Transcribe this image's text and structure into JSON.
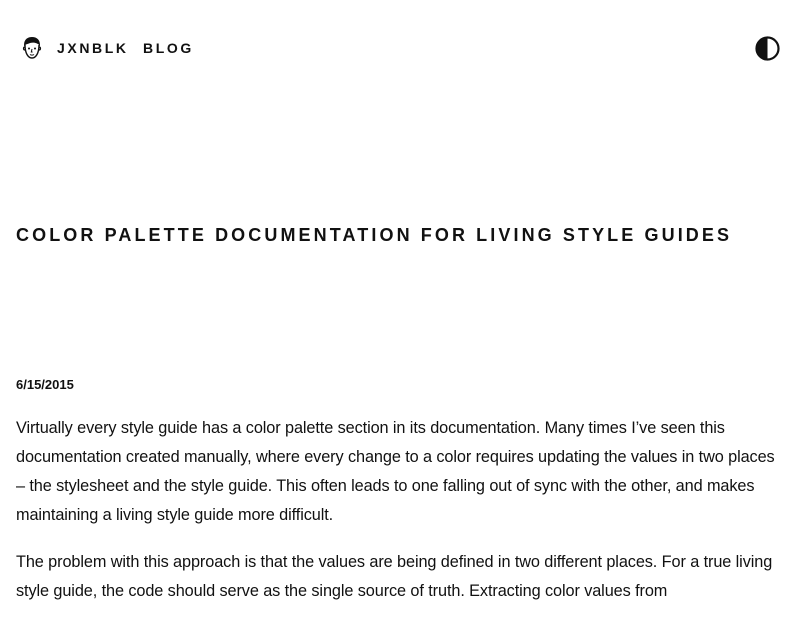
{
  "header": {
    "site_name": "JXNBLK",
    "nav_blog": "BLOG",
    "avatar_icon": "face-avatar-icon",
    "theme_toggle_icon": "contrast-half-circle-icon"
  },
  "post": {
    "title": "COLOR PALETTE DOCUMENTATION FOR LIVING STYLE GUIDES",
    "date": "6/15/2015",
    "paragraphs": [
      "Virtually every style guide has a color palette section in its documentation. Many times I’ve seen this documentation created manually, where every change to a color requires updating the values in two places – the stylesheet and the style guide. This often leads to one falling out of sync with the other, and makes maintaining a living style guide more difficult.",
      "The problem with this approach is that the values are being defined in two different places. For a true living style guide, the code should serve as the single source of truth. Extracting color values from"
    ]
  },
  "colors": {
    "background": "#ffffff",
    "text": "#111111"
  }
}
